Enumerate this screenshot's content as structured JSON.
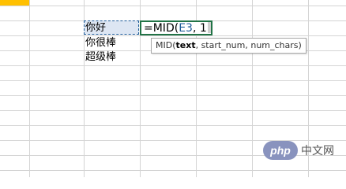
{
  "cells": {
    "e3": "你好",
    "e4": "你很棒",
    "e5": "超级棒"
  },
  "formula": {
    "prefix": "=MID(",
    "ref": "E3",
    "sep": ",",
    "arg": "1"
  },
  "tooltip": {
    "fn": "MID(",
    "arg_active": "text",
    "rest": ", start_num, num_chars)"
  },
  "watermark": {
    "logo": "php",
    "text": "中文网"
  },
  "colors": {
    "accent": "#217346",
    "ref_blue": "#1f5c99",
    "highlight": "#ffc000"
  }
}
